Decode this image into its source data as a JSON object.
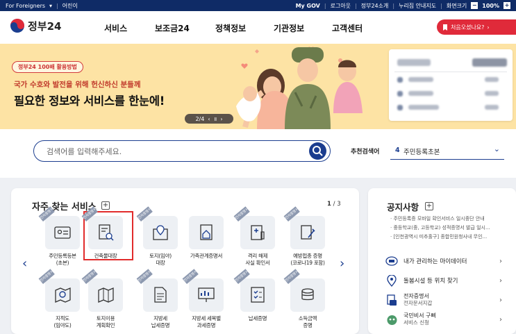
{
  "topbar": {
    "foreigners": "For Foreigners",
    "kids": "어린이",
    "mygov": "My GOV",
    "logout": "로그아웃",
    "intro": "정부24소개",
    "sitemap": "누리집 안내지도",
    "zoom_label": "화면크기",
    "zoom_value": "100%"
  },
  "header": {
    "logo_text": "정부24",
    "nav": [
      "서비스",
      "보조금24",
      "정책정보",
      "기관정보",
      "고객센터"
    ],
    "first_visit": "처음오셨나요?"
  },
  "banner": {
    "badge": "정부24 100배 활용방법",
    "subtitle": "국가 수호와 발전을 위해 헌신하신 분들께",
    "title": "필요한 정보와 서비스를 한눈에!",
    "pager": "2/4",
    "pager_prev": "‹",
    "pager_pause": "॥",
    "pager_next": "›"
  },
  "search": {
    "placeholder": "검색어를 입력해주세요.",
    "recommend_label": "추천검색어",
    "recommend_num": "4",
    "recommend_value": "주민등록초본"
  },
  "frequent": {
    "title": "자주 찾는 서비스",
    "page_current": "1",
    "page_total": "/ 3",
    "badge": "전자증명서",
    "items": [
      {
        "label": "주민등록등본\n(초본)",
        "icon": "id-card-icon",
        "badge": true
      },
      {
        "label": "건축물대장",
        "icon": "document-search-icon",
        "badge": true
      },
      {
        "label": "토지(임야)\n대장",
        "icon": "map-pin-icon",
        "badge": true
      },
      {
        "label": "가족관계증명서",
        "icon": "house-doc-icon",
        "badge": false
      },
      {
        "label": "격리 해제\n사실 확인서",
        "icon": "medical-doc-icon",
        "badge": true
      },
      {
        "label": "예방접종 증명\n(코로나19 포함)",
        "icon": "syringe-icon",
        "badge": true
      },
      {
        "label": "지적도\n(임야도)",
        "icon": "map-search-icon",
        "badge": true
      },
      {
        "label": "토지이용\n계획확인",
        "icon": "map-folded-icon",
        "badge": true
      },
      {
        "label": "지방세\n납세증명",
        "icon": "file-icon",
        "badge": true
      },
      {
        "label": "지방세 세목별\n과세증명",
        "icon": "chart-board-icon",
        "badge": true
      },
      {
        "label": "납세증명",
        "icon": "checklist-icon",
        "badge": true
      },
      {
        "label": "소득금액\n증명",
        "icon": "coins-icon",
        "badge": true
      }
    ]
  },
  "notice": {
    "title": "공지사항",
    "items": [
      "주민등록증 모바일 확인서비스 일시중단 안내",
      "중등학교(중, 고등학교) 성적증명서 발급 일시...",
      "[인천광역시 미추홀구] 종합민원청사내 무인..."
    ],
    "menu": [
      {
        "label": "내가 관리하는 마이데이터",
        "icon": "data-cloud-icon"
      },
      {
        "label": "돌봄시설 등 위치 찾기",
        "icon": "location-pin-icon"
      },
      {
        "label": "전자증명서",
        "sub": "전자문서지갑",
        "icon": "wallet-doc-icon"
      },
      {
        "label": "국민비서 구삐",
        "sub": "서비스 신청",
        "icon": "robot-icon"
      }
    ]
  },
  "colors": {
    "navy": "#0f2b66",
    "accent_blue": "#1b3d8f",
    "red": "#e02a3a",
    "banner_bg": "#fde3a4"
  }
}
